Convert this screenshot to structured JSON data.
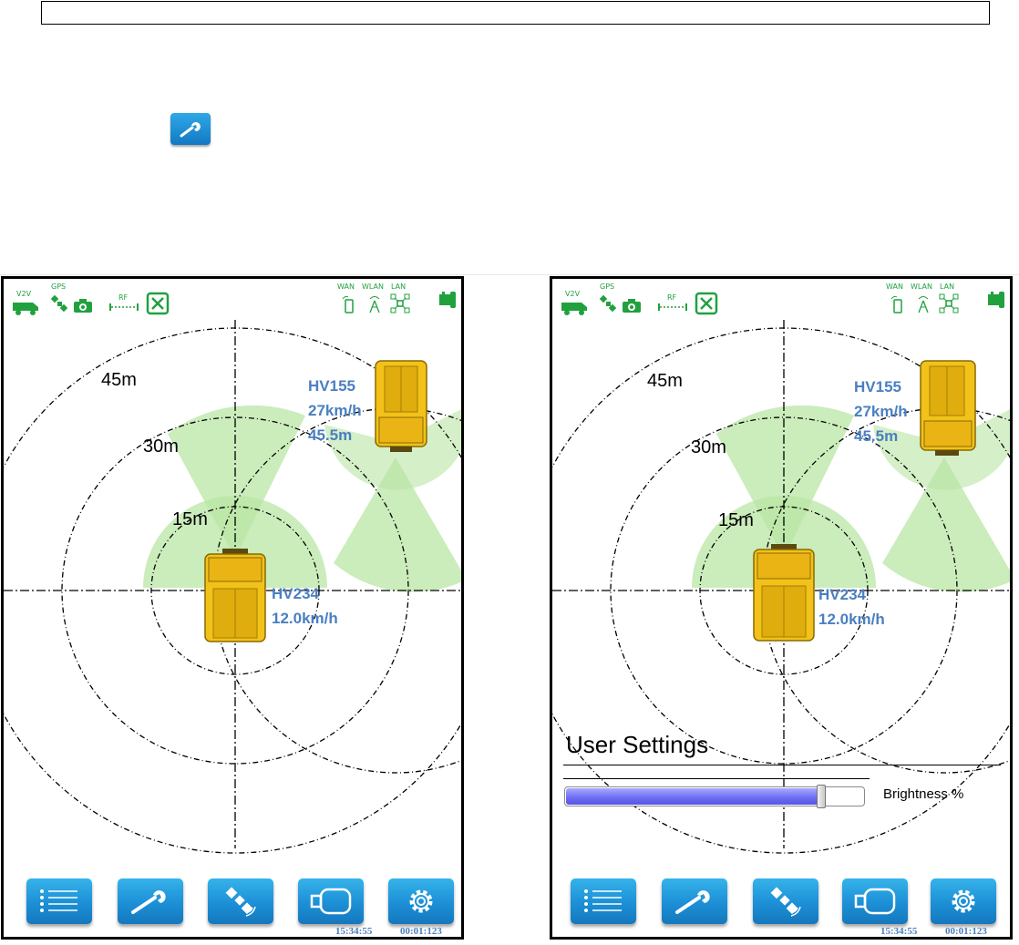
{
  "top_button": {
    "icon": "wrench-icon"
  },
  "screens": [
    {
      "id": "left",
      "status": {
        "v2v": "V2V",
        "gps": "GPS",
        "rf": "RF",
        "wan": "WAN",
        "wlan": "WLAN",
        "lan": "LAN"
      },
      "radius_labels": [
        "15m",
        "30m",
        "45m"
      ],
      "vehicles": [
        {
          "id": "HV234",
          "speed": "12.0km/h"
        },
        {
          "id": "HV155",
          "speed": "27km/h",
          "distance": "45.5m"
        }
      ],
      "toolbar": [
        "list-icon",
        "wrench-icon",
        "satellite-icon",
        "camera-icon",
        "gear-icon"
      ],
      "clock": {
        "time": "15:34:55",
        "elapsed": "00:01:123"
      }
    },
    {
      "id": "right",
      "status": {
        "v2v": "V2V",
        "gps": "GPS",
        "rf": "RF",
        "wan": "WAN",
        "wlan": "WLAN",
        "lan": "LAN"
      },
      "radius_labels": [
        "15m",
        "30m",
        "45m"
      ],
      "vehicles": [
        {
          "id": "HV234",
          "speed": "12.0km/h"
        },
        {
          "id": "HV155",
          "speed": "27km/h",
          "distance": "45.5m"
        }
      ],
      "settings": {
        "title": "User Settings",
        "brightness_label": "Brightness %",
        "brightness_value": 0.86
      },
      "toolbar": [
        "list-icon",
        "wrench-icon",
        "satellite-icon",
        "camera-icon",
        "gear-icon"
      ],
      "clock": {
        "time": "15:34:55",
        "elapsed": "00:01:123"
      }
    }
  ],
  "colors": {
    "status_green": "#21a13e",
    "sector_green": "#b9e5a4",
    "vehicle_yellow": "#f2c21b",
    "label_blue": "#4a7fc1",
    "button_blue": "#1c8fd6",
    "slider_fill": "#6b6bf2"
  }
}
